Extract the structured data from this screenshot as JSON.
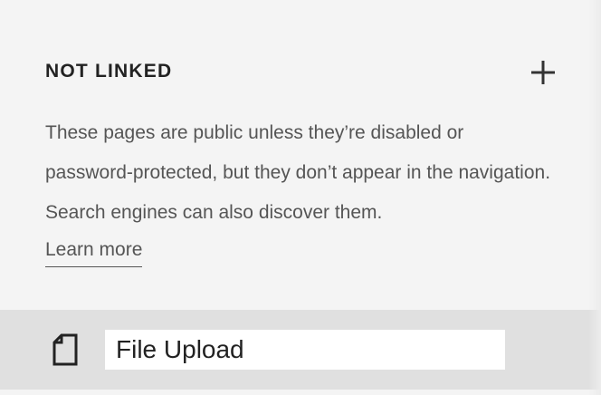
{
  "section": {
    "title": "NOT LINKED",
    "add_icon": "plus-icon",
    "description": "These pages are public unless they’re disabled or password-protected, but they don’t appear in the navigation. Search engines can also discover them.",
    "learn_more_label": "Learn more"
  },
  "pages": [
    {
      "icon": "page-icon",
      "title_value": "File Upload"
    }
  ],
  "colors": {
    "panel_background": "#f4f4f4",
    "selected_row_background": "#e0e0e0",
    "heading_text": "#222222",
    "body_text": "#555555",
    "input_background": "#ffffff"
  }
}
